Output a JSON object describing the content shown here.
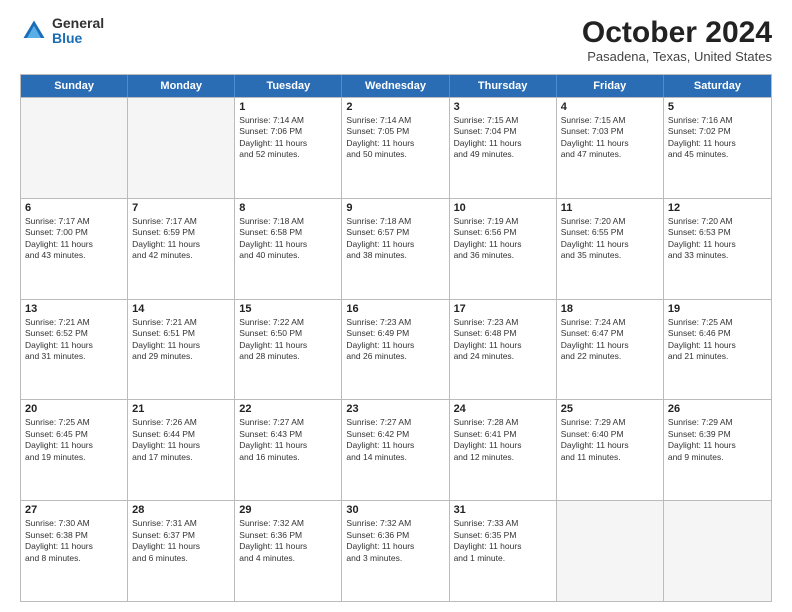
{
  "logo": {
    "general": "General",
    "blue": "Blue",
    "icon_color": "#1a6eb5"
  },
  "title": "October 2024",
  "location": "Pasadena, Texas, United States",
  "headers": [
    "Sunday",
    "Monday",
    "Tuesday",
    "Wednesday",
    "Thursday",
    "Friday",
    "Saturday"
  ],
  "weeks": [
    [
      {
        "day": "",
        "info": ""
      },
      {
        "day": "",
        "info": ""
      },
      {
        "day": "1",
        "info": "Sunrise: 7:14 AM\nSunset: 7:06 PM\nDaylight: 11 hours\nand 52 minutes."
      },
      {
        "day": "2",
        "info": "Sunrise: 7:14 AM\nSunset: 7:05 PM\nDaylight: 11 hours\nand 50 minutes."
      },
      {
        "day": "3",
        "info": "Sunrise: 7:15 AM\nSunset: 7:04 PM\nDaylight: 11 hours\nand 49 minutes."
      },
      {
        "day": "4",
        "info": "Sunrise: 7:15 AM\nSunset: 7:03 PM\nDaylight: 11 hours\nand 47 minutes."
      },
      {
        "day": "5",
        "info": "Sunrise: 7:16 AM\nSunset: 7:02 PM\nDaylight: 11 hours\nand 45 minutes."
      }
    ],
    [
      {
        "day": "6",
        "info": "Sunrise: 7:17 AM\nSunset: 7:00 PM\nDaylight: 11 hours\nand 43 minutes."
      },
      {
        "day": "7",
        "info": "Sunrise: 7:17 AM\nSunset: 6:59 PM\nDaylight: 11 hours\nand 42 minutes."
      },
      {
        "day": "8",
        "info": "Sunrise: 7:18 AM\nSunset: 6:58 PM\nDaylight: 11 hours\nand 40 minutes."
      },
      {
        "day": "9",
        "info": "Sunrise: 7:18 AM\nSunset: 6:57 PM\nDaylight: 11 hours\nand 38 minutes."
      },
      {
        "day": "10",
        "info": "Sunrise: 7:19 AM\nSunset: 6:56 PM\nDaylight: 11 hours\nand 36 minutes."
      },
      {
        "day": "11",
        "info": "Sunrise: 7:20 AM\nSunset: 6:55 PM\nDaylight: 11 hours\nand 35 minutes."
      },
      {
        "day": "12",
        "info": "Sunrise: 7:20 AM\nSunset: 6:53 PM\nDaylight: 11 hours\nand 33 minutes."
      }
    ],
    [
      {
        "day": "13",
        "info": "Sunrise: 7:21 AM\nSunset: 6:52 PM\nDaylight: 11 hours\nand 31 minutes."
      },
      {
        "day": "14",
        "info": "Sunrise: 7:21 AM\nSunset: 6:51 PM\nDaylight: 11 hours\nand 29 minutes."
      },
      {
        "day": "15",
        "info": "Sunrise: 7:22 AM\nSunset: 6:50 PM\nDaylight: 11 hours\nand 28 minutes."
      },
      {
        "day": "16",
        "info": "Sunrise: 7:23 AM\nSunset: 6:49 PM\nDaylight: 11 hours\nand 26 minutes."
      },
      {
        "day": "17",
        "info": "Sunrise: 7:23 AM\nSunset: 6:48 PM\nDaylight: 11 hours\nand 24 minutes."
      },
      {
        "day": "18",
        "info": "Sunrise: 7:24 AM\nSunset: 6:47 PM\nDaylight: 11 hours\nand 22 minutes."
      },
      {
        "day": "19",
        "info": "Sunrise: 7:25 AM\nSunset: 6:46 PM\nDaylight: 11 hours\nand 21 minutes."
      }
    ],
    [
      {
        "day": "20",
        "info": "Sunrise: 7:25 AM\nSunset: 6:45 PM\nDaylight: 11 hours\nand 19 minutes."
      },
      {
        "day": "21",
        "info": "Sunrise: 7:26 AM\nSunset: 6:44 PM\nDaylight: 11 hours\nand 17 minutes."
      },
      {
        "day": "22",
        "info": "Sunrise: 7:27 AM\nSunset: 6:43 PM\nDaylight: 11 hours\nand 16 minutes."
      },
      {
        "day": "23",
        "info": "Sunrise: 7:27 AM\nSunset: 6:42 PM\nDaylight: 11 hours\nand 14 minutes."
      },
      {
        "day": "24",
        "info": "Sunrise: 7:28 AM\nSunset: 6:41 PM\nDaylight: 11 hours\nand 12 minutes."
      },
      {
        "day": "25",
        "info": "Sunrise: 7:29 AM\nSunset: 6:40 PM\nDaylight: 11 hours\nand 11 minutes."
      },
      {
        "day": "26",
        "info": "Sunrise: 7:29 AM\nSunset: 6:39 PM\nDaylight: 11 hours\nand 9 minutes."
      }
    ],
    [
      {
        "day": "27",
        "info": "Sunrise: 7:30 AM\nSunset: 6:38 PM\nDaylight: 11 hours\nand 8 minutes."
      },
      {
        "day": "28",
        "info": "Sunrise: 7:31 AM\nSunset: 6:37 PM\nDaylight: 11 hours\nand 6 minutes."
      },
      {
        "day": "29",
        "info": "Sunrise: 7:32 AM\nSunset: 6:36 PM\nDaylight: 11 hours\nand 4 minutes."
      },
      {
        "day": "30",
        "info": "Sunrise: 7:32 AM\nSunset: 6:36 PM\nDaylight: 11 hours\nand 3 minutes."
      },
      {
        "day": "31",
        "info": "Sunrise: 7:33 AM\nSunset: 6:35 PM\nDaylight: 11 hours\nand 1 minute."
      },
      {
        "day": "",
        "info": ""
      },
      {
        "day": "",
        "info": ""
      }
    ]
  ]
}
